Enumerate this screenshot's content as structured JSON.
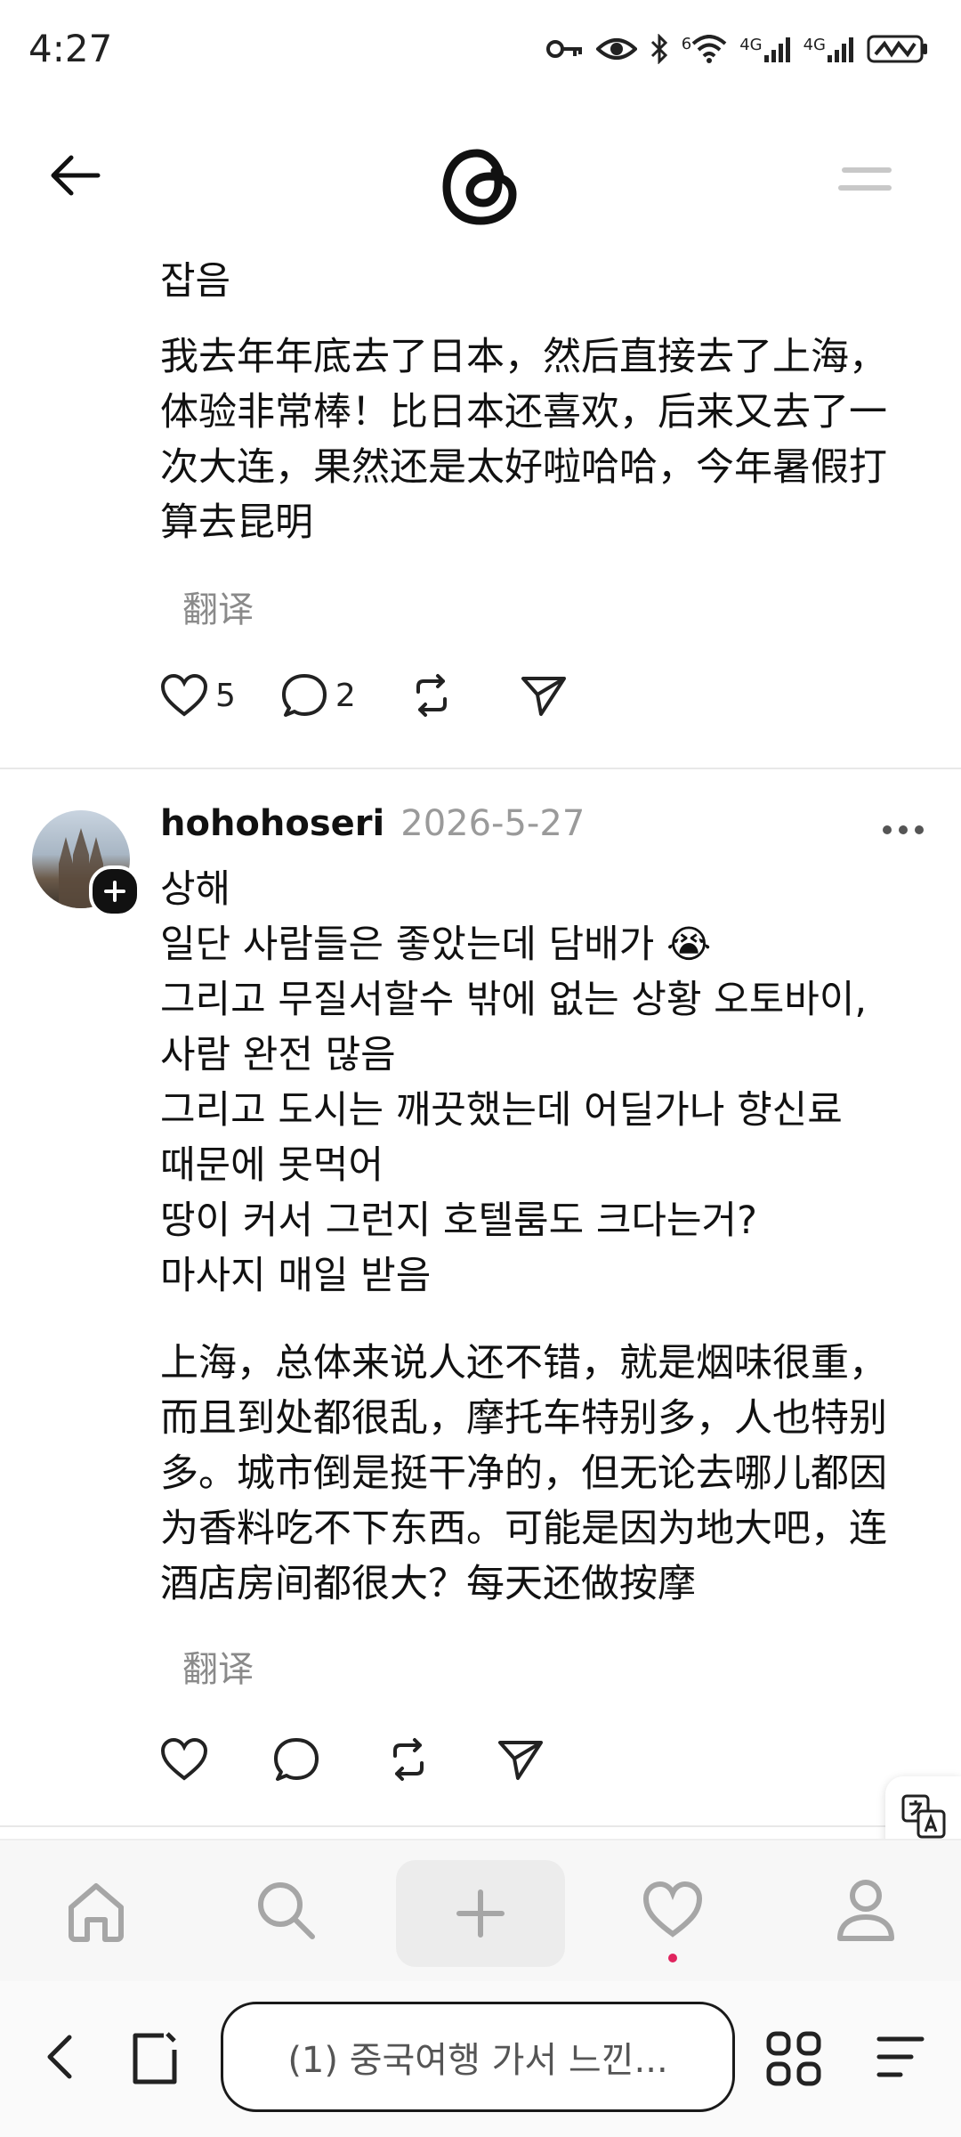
{
  "status_bar": {
    "time": "4:27",
    "net1": "6",
    "net2": "4G",
    "net3": "4G"
  },
  "post1": {
    "korean_line": "잡음",
    "chinese_text": [
      "我去年年底去了日本，然后直接去了上海，",
      "体验非常棒！比日本还喜欢，后来又去了一",
      "次大连，果然还是太好啦哈哈，今年暑假打",
      "算去昆明"
    ],
    "translate_label": "翻译",
    "likes": "5",
    "comments": "2"
  },
  "post2": {
    "username": "hohohoseri",
    "date": "2026-5-27",
    "korean_text": [
      "상해",
      "일단 사람들은 좋았는데 담배가 😭",
      "그리고 무질서할수 밖에 없는 상황 오토바이,",
      "사람 완전 많음",
      "그리고 도시는 깨끗했는데 어딜가나 향신료",
      "때문에 못먹어",
      "땅이 커서 그런지 호텔룸도 크다는거?",
      "마사지 매일 받음"
    ],
    "chinese_text": [
      "上海，总体来说人还不错，就是烟味很重，",
      "而且到处都很乱，摩托车特别多，人也特别",
      "多。城市倒是挺干净的，但无论去哪儿都因",
      "为香料吃不下东西。可能是因为地大吧，连",
      "酒店房间都很大？每天还做按摩"
    ],
    "translate_label": "翻译"
  },
  "browser_bar": {
    "url_text": "(1) 중국여행 가서 느낀..."
  },
  "colors": {
    "accent_dot": "#e0245e",
    "text": "#111111",
    "muted": "#8a8a8a"
  }
}
